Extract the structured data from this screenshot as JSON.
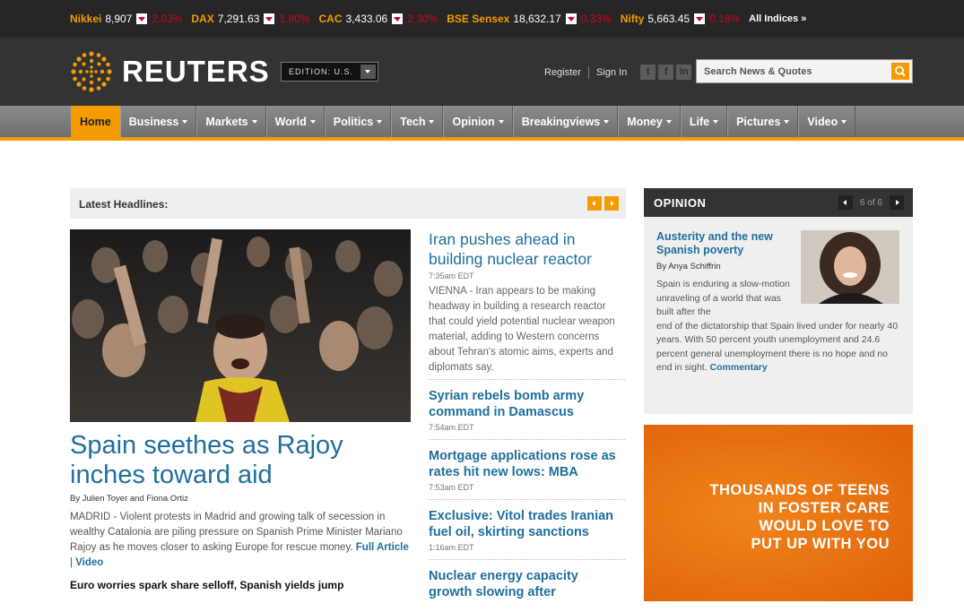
{
  "ticker": {
    "indices": [
      {
        "name": "Nikkei",
        "value": "8,907",
        "change": "2.03%"
      },
      {
        "name": "DAX",
        "value": "7,291.63",
        "change": "1.80%"
      },
      {
        "name": "CAC",
        "value": "3,433.06",
        "change": "2.30%"
      },
      {
        "name": "BSE Sensex",
        "value": "18,632.17",
        "change": "0.33%"
      },
      {
        "name": "Nifty",
        "value": "5,663.45",
        "change": "0.18%"
      }
    ],
    "all_link": "All Indices »"
  },
  "header": {
    "brand": "REUTERS",
    "edition": "EDITION: U.S.",
    "register": "Register",
    "signin": "Sign In",
    "social": [
      "t",
      "f",
      "in"
    ],
    "search_placeholder": "Search News & Quotes"
  },
  "nav": {
    "items": [
      "Home",
      "Business",
      "Markets",
      "World",
      "Politics",
      "Tech",
      "Opinion",
      "Breakingviews",
      "Money",
      "Life",
      "Pictures",
      "Video"
    ]
  },
  "latest": {
    "label": "Latest Headlines:"
  },
  "lead": {
    "title": "Spain seethes as Rajoy inches toward aid",
    "byline": "By Julien Toyer and Fiona Ortiz",
    "summary": "MADRID - Violent protests in Madrid and growing talk of secession in wealthy Catalonia are piling pressure on Spanish Prime Minister Mariano Rajoy as he moves closer to asking Europe for rescue money.",
    "full_article": "Full Article",
    "video": "Video",
    "related": "Euro worries spark share selloff, Spanish yields jump"
  },
  "mid": {
    "stories": [
      {
        "title": "Iran pushes ahead in building nuclear reactor",
        "time": "7:35am EDT",
        "summary": "VIENNA - Iran appears to be making headway in building a research reactor that could yield potential nuclear weapon material, adding to Western concerns about Tehran's atomic aims, experts and diplomats say."
      },
      {
        "title": "Syrian rebels bomb army command in Damascus",
        "time": "7:54am EDT"
      },
      {
        "title": "Mortgage applications rose as rates hit new lows: MBA",
        "time": "7:53am EDT"
      },
      {
        "title": "Exclusive: Vitol trades Iranian fuel oil, skirting sanctions",
        "time": "1:16am EDT"
      },
      {
        "title": "Nuclear energy capacity growth slowing after"
      }
    ]
  },
  "opinion": {
    "title": "OPINION",
    "counter": "6 of 6",
    "headline": "Austerity and the new Spanish poverty",
    "author": "By Anya Schiffrin",
    "summary_narrow": "Spain is enduring a slow-motion unraveling of a world that was built after the",
    "summary_wide": "end of the dictatorship that Spain lived under for nearly 40 years. With 50 percent youth unemployment and 24.6 percent general unemployment there is no hope and no end in sight.",
    "link": "Commentary"
  },
  "ad": {
    "lines": [
      "THOUSANDS OF TEENS",
      "IN FOSTER CARE",
      "WOULD LOVE TO",
      "PUT UP WITH YOU"
    ]
  },
  "colors": {
    "accent": "#f49b00",
    "link": "#1f6f9e",
    "down": "#d4001a"
  }
}
